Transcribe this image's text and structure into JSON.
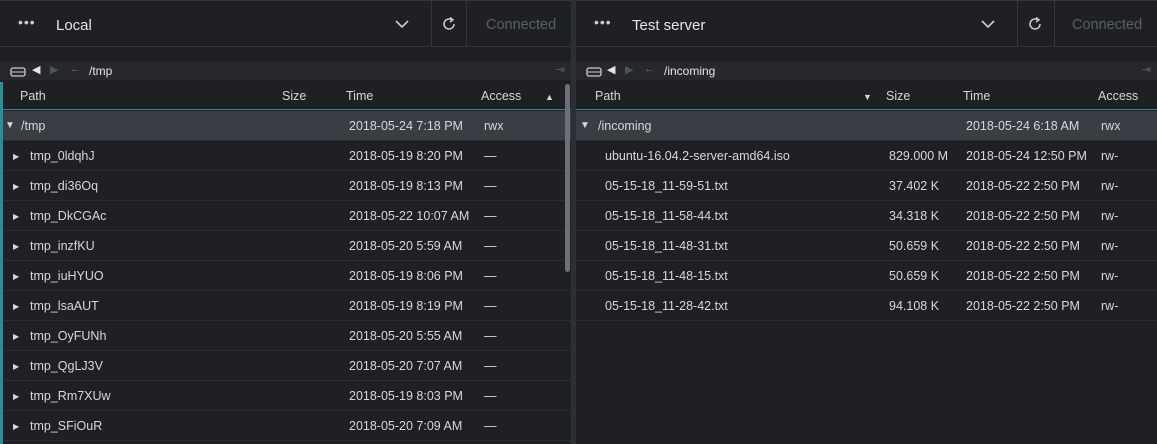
{
  "left": {
    "connection": "Local",
    "status": "Connected",
    "path": "/tmp",
    "columns": {
      "path": "Path",
      "size": "Size",
      "time": "Time",
      "access": "Access"
    },
    "rows": [
      {
        "name": "/tmp",
        "time": "2018-05-24 7:18 PM",
        "access": "rwx"
      },
      {
        "name": "tmp_0ldqhJ",
        "time": "2018-05-19 8:20 PM",
        "access": "—"
      },
      {
        "name": "tmp_di36Oq",
        "time": "2018-05-19 8:13 PM",
        "access": "—"
      },
      {
        "name": "tmp_DkCGAc",
        "time": "2018-05-22 10:07 AM",
        "access": "—"
      },
      {
        "name": "tmp_inzfKU",
        "time": "2018-05-20 5:59 AM",
        "access": "—"
      },
      {
        "name": "tmp_iuHYUO",
        "time": "2018-05-19 8:06 PM",
        "access": "—"
      },
      {
        "name": "tmp_lsaAUT",
        "time": "2018-05-19 8:19 PM",
        "access": "—"
      },
      {
        "name": "tmp_OyFUNh",
        "time": "2018-05-20 5:55 AM",
        "access": "—"
      },
      {
        "name": "tmp_QgLJ3V",
        "time": "2018-05-20 7:07 AM",
        "access": "—"
      },
      {
        "name": "tmp_Rm7XUw",
        "time": "2018-05-19 8:03 PM",
        "access": "—"
      },
      {
        "name": "tmp_SFiOuR",
        "time": "2018-05-20 7:09 AM",
        "access": "—"
      }
    ]
  },
  "right": {
    "connection": "Test server",
    "status": "Connected",
    "path": "/incoming",
    "columns": {
      "path": "Path",
      "size": "Size",
      "time": "Time",
      "access": "Access"
    },
    "rows": [
      {
        "name": "/incoming",
        "size": "",
        "time": "2018-05-24 6:18 AM",
        "access": "rwx"
      },
      {
        "name": "ubuntu-16.04.2-server-amd64.iso",
        "size": "829.000 M",
        "time": "2018-05-24 12:50 PM",
        "access": "rw-"
      },
      {
        "name": "05-15-18_11-59-51.txt",
        "size": "37.402 K",
        "time": "2018-05-22 2:50 PM",
        "access": "rw-"
      },
      {
        "name": "05-15-18_11-58-44.txt",
        "size": "34.318 K",
        "time": "2018-05-22 2:50 PM",
        "access": "rw-"
      },
      {
        "name": "05-15-18_11-48-31.txt",
        "size": "50.659 K",
        "time": "2018-05-22 2:50 PM",
        "access": "rw-"
      },
      {
        "name": "05-15-18_11-48-15.txt",
        "size": "50.659 K",
        "time": "2018-05-22 2:50 PM",
        "access": "rw-"
      },
      {
        "name": "05-15-18_11-28-42.txt",
        "size": "94.108 K",
        "time": "2018-05-22 2:50 PM",
        "access": "rw-"
      }
    ]
  },
  "icons": {
    "menu": "more-dots-icon",
    "dropdown": "chevron-down-icon",
    "refresh": "refresh-icon",
    "drive": "drive-icon",
    "back": "arrow-back-icon",
    "forward": "arrow-forward-icon",
    "up": "arrow-left-icon",
    "pin": "pin-panel-icon"
  },
  "colors": {
    "accent": "#2a8f9a",
    "background": "#1f2024",
    "selected_row": "#3a3d44",
    "status_text": "#5a5e66"
  }
}
